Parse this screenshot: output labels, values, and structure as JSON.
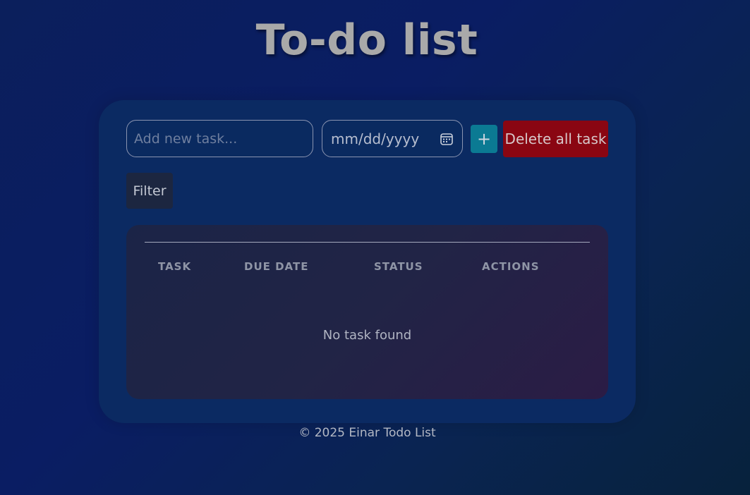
{
  "app": {
    "title": "To-do list"
  },
  "form": {
    "task_placeholder": "Add new task...",
    "date_placeholder": "mm/dd/yyyy",
    "add_label": "+",
    "delete_all_label": "Delete all task",
    "filter_label": "Filter"
  },
  "table": {
    "columns": [
      "TASK",
      "DUE DATE",
      "STATUS",
      "ACTIONS"
    ],
    "empty_message": "No task found"
  },
  "footer": {
    "text": "© 2025 Einar Todo List"
  },
  "colors": {
    "add_button": "#0b7a93",
    "delete_button": "#8a0612",
    "filter_button": "#1c2640"
  }
}
